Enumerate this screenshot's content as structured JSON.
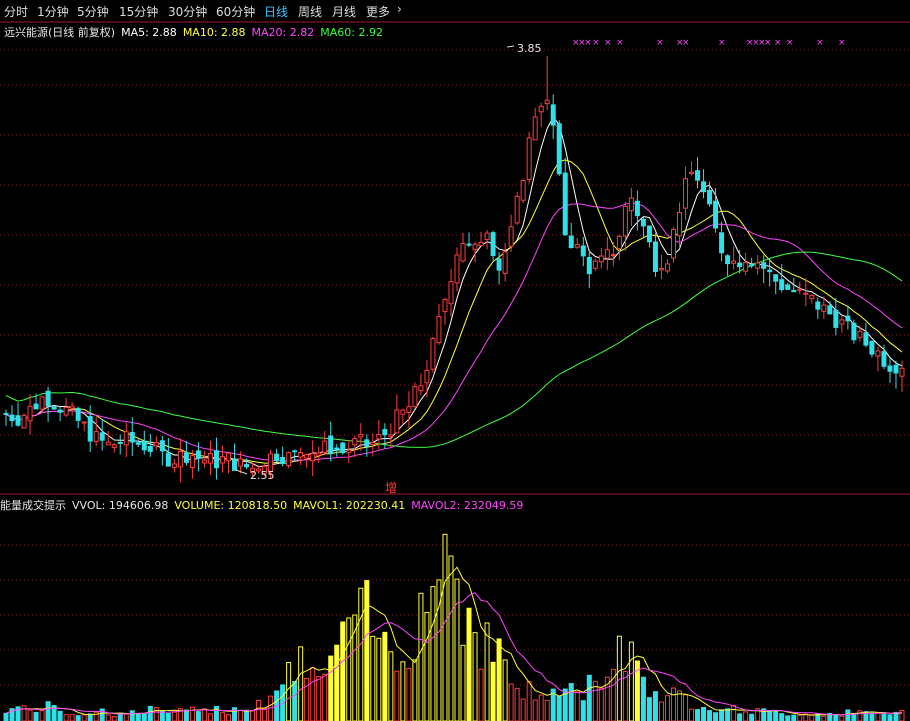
{
  "tabs": [
    {
      "label": "分时",
      "active": false
    },
    {
      "label": "1分钟",
      "active": false
    },
    {
      "label": "5分钟",
      "active": false
    },
    {
      "label": "15分钟",
      "active": false
    },
    {
      "label": "30分钟",
      "active": false
    },
    {
      "label": "60分钟",
      "active": false
    },
    {
      "label": "日线",
      "active": true
    },
    {
      "label": "周线",
      "active": false
    },
    {
      "label": "月线",
      "active": false
    },
    {
      "label": "更多",
      "active": false
    }
  ],
  "more_icon": "chevron-right-icon",
  "price_panel": {
    "title": "远兴能源(日线 前复权)",
    "ma5": "MA5: 2.88",
    "ma10": "MA10: 2.88",
    "ma20": "MA20: 2.82",
    "ma60": "MA60: 2.92",
    "high_label": "3.85",
    "low_label": "2.55",
    "marker": "增"
  },
  "volume_panel": {
    "title": "能量成交提示",
    "vvol": "VVOL: 194606.98",
    "volume": "VOLUME: 120818.50",
    "mavol1": "MAVOL1: 202230.41",
    "mavol2": "MAVOL2: 232049.59"
  },
  "colors": {
    "up": "#ff3b3b",
    "down": "#30e0e8",
    "ma5": "#ffffff",
    "ma10": "#ffff3c",
    "ma20": "#ff44ff",
    "ma60": "#3cff3c",
    "vol_yellow": "#ffff33",
    "active_tab": "#3ec3ff"
  },
  "chart_data": {
    "type": "candlestick",
    "ylim": [
      2.5,
      3.9
    ],
    "series_high": 3.85,
    "series_low": 2.55,
    "volume_ylim": [
      0,
      520000
    ],
    "price_path": [
      2.72,
      2.71,
      2.74,
      2.78,
      2.75,
      2.72,
      2.68,
      2.64,
      2.62,
      2.64,
      2.63,
      2.62,
      2.59,
      2.58,
      2.6,
      2.58,
      2.57,
      2.58,
      2.56,
      2.55,
      2.58,
      2.6,
      2.58,
      2.62,
      2.6,
      2.62,
      2.6,
      2.63,
      2.62,
      2.65,
      2.7,
      2.74,
      2.82,
      2.95,
      3.12,
      3.28,
      3.22,
      3.32,
      3.18,
      3.3,
      3.52,
      3.72,
      3.68,
      3.3,
      3.24,
      3.18,
      3.2,
      3.25,
      3.42,
      3.32,
      3.2,
      3.22,
      3.4,
      3.5,
      3.38,
      3.25,
      3.2,
      3.22,
      3.2,
      3.15,
      3.12,
      3.1,
      3.08,
      3.05,
      3.02,
      2.98,
      2.95,
      2.92,
      2.88,
      2.88
    ],
    "volume_path": [
      30000,
      35000,
      28000,
      40000,
      25000,
      22000,
      18000,
      30000,
      20000,
      18000,
      22000,
      30000,
      25000,
      20000,
      28000,
      22000,
      35000,
      25000,
      40000,
      30000,
      60000,
      90000,
      120000,
      160000,
      110000,
      150000,
      200000,
      280000,
      260000,
      200000,
      180000,
      230000,
      300000,
      400000,
      480000,
      330000,
      260000,
      200000,
      180000,
      100000,
      80000,
      60000,
      70000,
      80000,
      75000,
      90000,
      140000,
      160000,
      230000,
      110000,
      80000,
      70000,
      60000,
      50000,
      40000,
      35000,
      30000,
      28000,
      25000,
      22000,
      20000,
      20000,
      18000,
      20000,
      18000,
      22000,
      20000,
      19000,
      21000,
      20000
    ]
  }
}
